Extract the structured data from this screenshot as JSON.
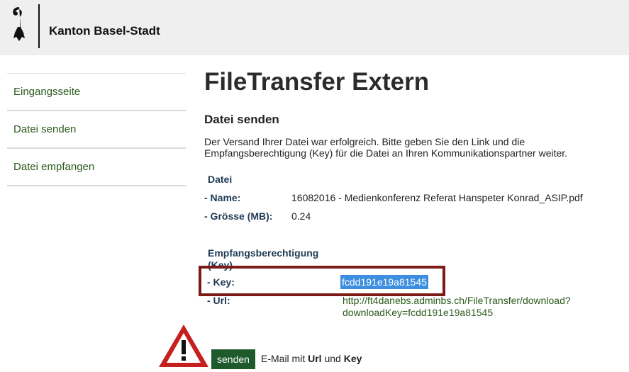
{
  "header": {
    "brand": "Kanton Basel-Stadt"
  },
  "sidebar": {
    "items": [
      {
        "label": "Eingangsseite"
      },
      {
        "label": "Datei senden"
      },
      {
        "label": "Datei empfangen"
      }
    ]
  },
  "main": {
    "title": "FileTransfer Extern",
    "section_title": "Datei senden",
    "intro": "Der Versand Ihrer Datei war erfolgreich. Bitte geben Sie den Link und die Empfangsberechtigung (Key) für die Datei an Ihren Kommunikationspartner weiter.",
    "file": {
      "heading": "Datei",
      "name_label": "- Name:",
      "name_value": "16082016 - Medienkonferenz Referat Hanspeter Konrad_ASIP.pdf",
      "size_label": "- Grösse (MB):",
      "size_value": "0.24"
    },
    "auth": {
      "heading": "Empfangsberechtigung (Key)",
      "key_label": "- Key:",
      "key_value": "fcdd191e19a81545",
      "url_label": "- Url:",
      "url_value": "http://ft4danebs.adminbs.ch/FileTransfer/download?downloadKey=fcdd191e19a81545"
    },
    "send": {
      "button_label": "senden",
      "note_prefix": "E-Mail mit ",
      "note_url": "Url",
      "note_mid": " und ",
      "note_key": "Key"
    }
  },
  "colors": {
    "highlight_border": "#7b1a16",
    "selection": "#3d8ee0",
    "button": "#1f5a2b",
    "link": "#2a5a1b"
  },
  "icons": {
    "logo": "basel-crozier-icon",
    "warning": "warning-triangle-icon"
  }
}
